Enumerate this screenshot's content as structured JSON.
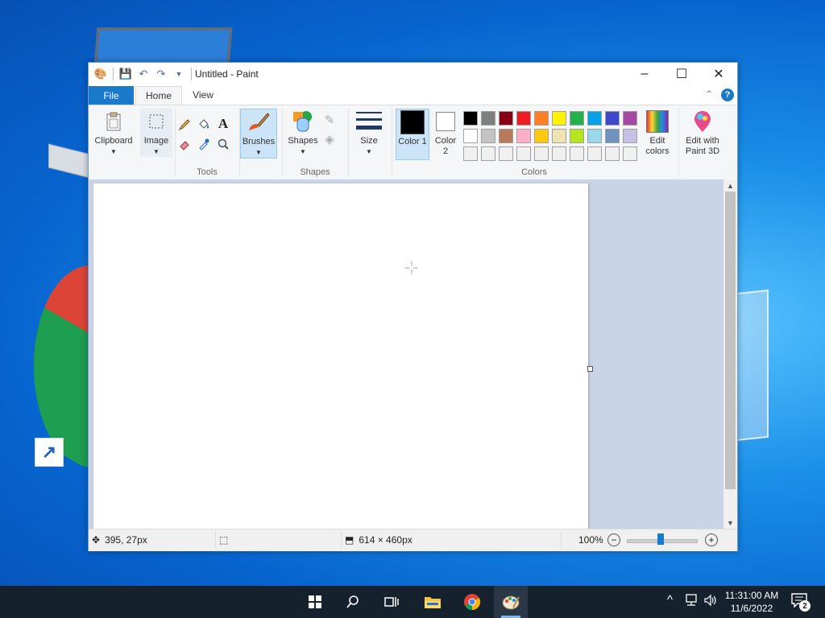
{
  "window": {
    "title": "Untitled - Paint",
    "minimize": "–",
    "maximize": "☐",
    "close": "✕"
  },
  "tabs": [
    {
      "label": "File"
    },
    {
      "label": "Home"
    },
    {
      "label": "View"
    }
  ],
  "help_label": "?",
  "collapse_label": "⌃",
  "ribbon": {
    "clipboard": {
      "label": "Clipboard"
    },
    "image": {
      "label": "Image"
    },
    "tools_group": "Tools",
    "brushes": {
      "label": "Brushes"
    },
    "shapes": {
      "label": "Shapes"
    },
    "shapes_group": "Shapes",
    "size": {
      "label": "Size"
    },
    "color1": {
      "label": "Color 1",
      "value": "#000000"
    },
    "color2": {
      "label": "Color 2",
      "value": "#ffffff"
    },
    "colors_group": "Colors",
    "edit_colors": {
      "label": "Edit colors"
    },
    "paint3d": {
      "label": "Edit with Paint 3D"
    }
  },
  "palette": {
    "row1": [
      "#000000",
      "#7f7f7f",
      "#880015",
      "#ed1c24",
      "#ff7f27",
      "#fff200",
      "#22b14c",
      "#00a2e8",
      "#3f48cc",
      "#a349a4"
    ],
    "row2": [
      "#ffffff",
      "#c3c3c3",
      "#b97a57",
      "#ffaec9",
      "#ffc90e",
      "#efe4b0",
      "#b5e61d",
      "#99d9ea",
      "#7092be",
      "#c8bfe7"
    ],
    "row3": [
      "#f0f0f0",
      "#f0f0f0",
      "#f0f0f0",
      "#f0f0f0",
      "#f0f0f0",
      "#f0f0f0",
      "#f0f0f0",
      "#f0f0f0",
      "#f0f0f0",
      "#f0f0f0"
    ]
  },
  "status": {
    "cursor_pos": "395, 27px",
    "selection_size": "",
    "canvas_size": "614 × 460px",
    "zoom": "100%"
  },
  "taskbar": {
    "time": "11:31:00 AM",
    "date": "11/6/2022",
    "notification_count": "2"
  }
}
